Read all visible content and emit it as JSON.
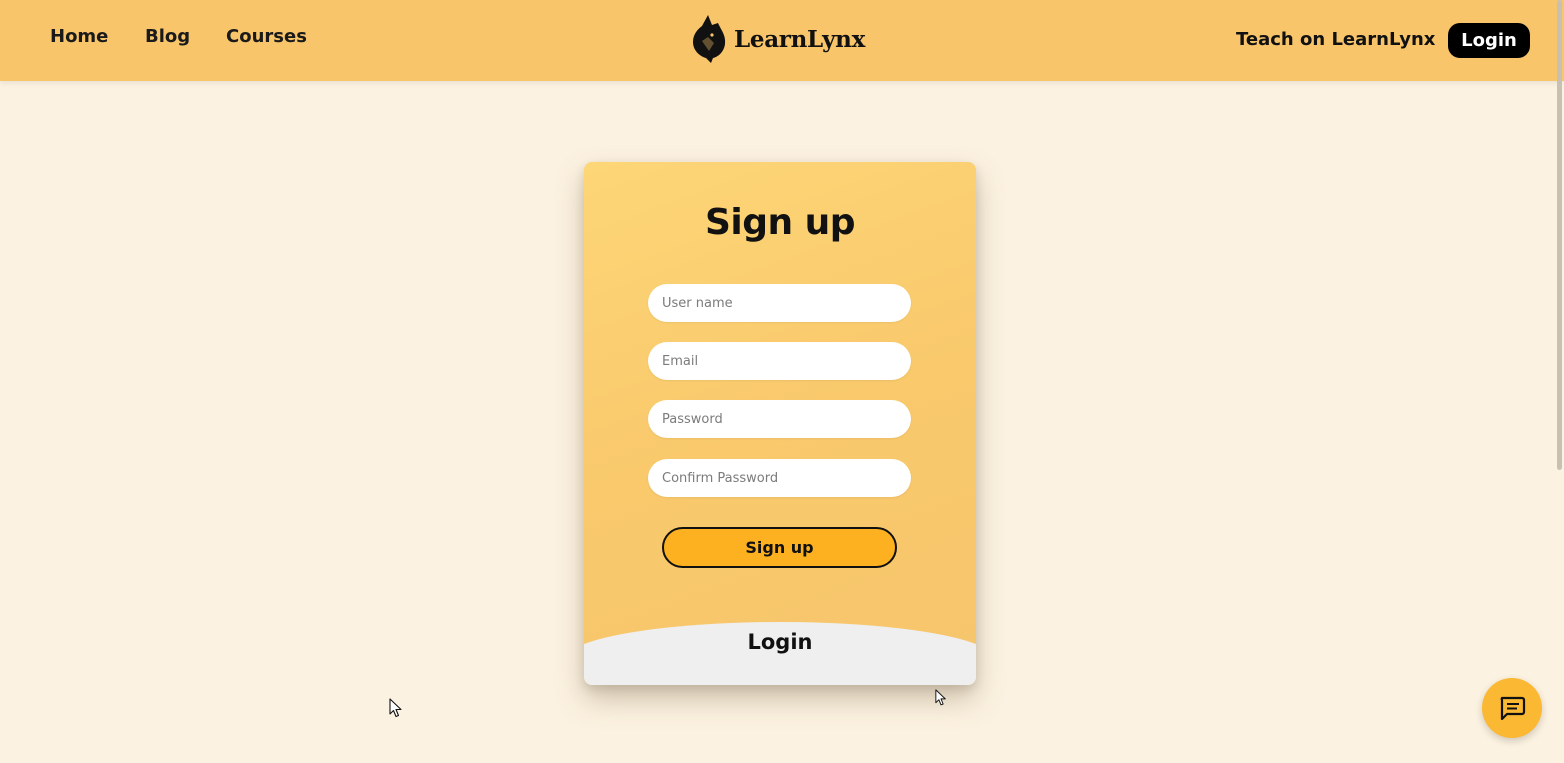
{
  "nav": {
    "links": [
      {
        "label": "Home"
      },
      {
        "label": "Blog"
      },
      {
        "label": "Courses"
      }
    ],
    "logo_text": "LearnLynx",
    "teach_label": "Teach on LearnLynx",
    "login_label": "Login"
  },
  "signup_card": {
    "title": "Sign up",
    "fields": [
      {
        "placeholder": "User name",
        "value": ""
      },
      {
        "placeholder": "Email",
        "value": ""
      },
      {
        "placeholder": "Password",
        "value": ""
      },
      {
        "placeholder": "Confirm Password",
        "value": ""
      }
    ],
    "submit_label": "Sign up",
    "login_panel_label": "Login"
  },
  "colors": {
    "topbar": "#f8c56a",
    "page_background": "#fcf2e1",
    "card": "#f9c96c",
    "signup_button": "#fdb120",
    "login_button": "#000000",
    "chat_button": "#fbb832"
  },
  "icons": {
    "logo": "lynx-head-icon",
    "chat": "chat-bubble-icon",
    "cursor": "mouse-pointer-icon"
  }
}
